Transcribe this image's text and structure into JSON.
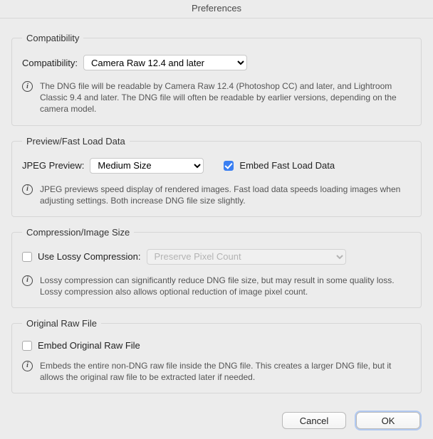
{
  "window": {
    "title": "Preferences"
  },
  "compat": {
    "legend": "Compatibility",
    "label": "Compatibility:",
    "selected": "Camera Raw 12.4 and later",
    "info": "The DNG file will be readable by Camera Raw 12.4 (Photoshop CC) and later, and Lightroom Classic 9.4 and later. The DNG file will often be readable by earlier versions, depending on the camera model."
  },
  "preview": {
    "legend": "Preview/Fast Load Data",
    "jpeg_label": "JPEG Preview:",
    "jpeg_selected": "Medium Size",
    "embed_fast_load": "Embed Fast Load Data",
    "info": "JPEG previews speed display of rendered images.  Fast load data speeds loading images when adjusting settings.  Both increase DNG file size slightly."
  },
  "compress": {
    "legend": "Compression/Image Size",
    "use_lossy": "Use Lossy Compression:",
    "lossy_selected": "Preserve Pixel Count",
    "info": "Lossy compression can significantly reduce DNG file size, but may result in some quality loss.  Lossy compression also allows optional reduction of image pixel count."
  },
  "original": {
    "legend": "Original Raw File",
    "embed": "Embed Original Raw File",
    "info": "Embeds the entire non-DNG raw file inside the DNG file.  This creates a larger DNG file, but it allows the original raw file to be extracted later if needed."
  },
  "footer": {
    "cancel": "Cancel",
    "ok": "OK"
  },
  "icons": {
    "info_glyph": "i"
  }
}
